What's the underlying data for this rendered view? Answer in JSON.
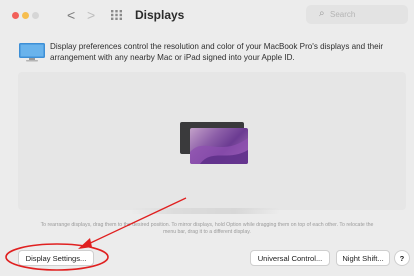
{
  "window": {
    "title": "Displays",
    "search_placeholder": "Search"
  },
  "nav": {
    "back": "<",
    "forward": ">"
  },
  "info": {
    "text": "Display preferences control the resolution and color of your MacBook Pro's displays and their arrangement with any nearby Mac or iPad signed into your Apple ID."
  },
  "arrangement": {
    "hint": "To rearrange displays, drag them to the desired position. To mirror displays, hold Option while dragging them on top of each other. To relocate the menu bar, drag it to a different display."
  },
  "buttons": {
    "display_settings": "Display Settings...",
    "universal_control": "Universal Control...",
    "night_shift": "Night Shift...",
    "help": "?"
  },
  "colors": {
    "annotation_red": "#e02020",
    "traffic_close": "#f2605a",
    "traffic_minimize": "#f6be4f"
  }
}
